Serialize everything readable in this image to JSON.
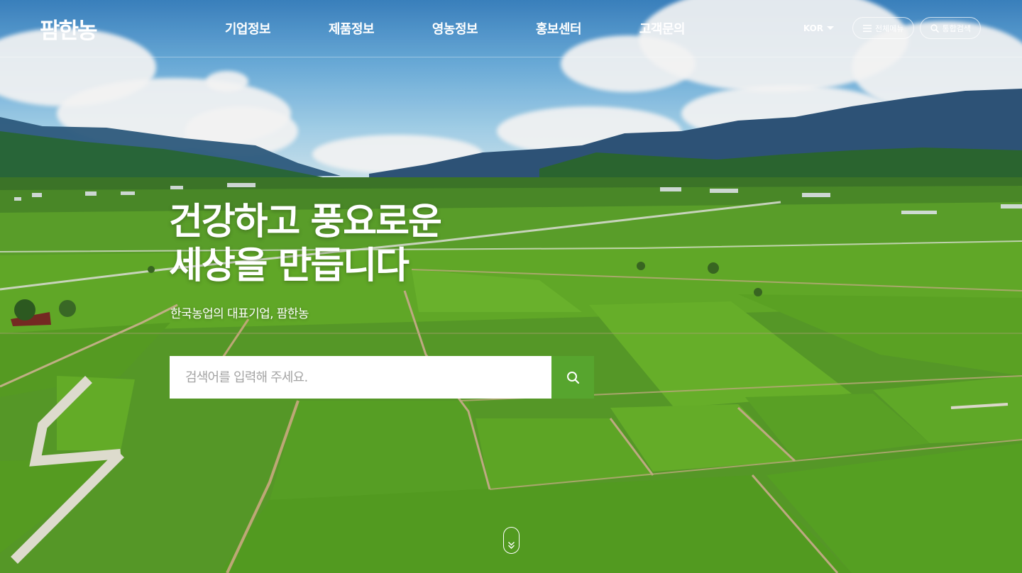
{
  "brand": {
    "logo_text": "팜한농"
  },
  "nav": {
    "items": [
      {
        "label": "기업정보"
      },
      {
        "label": "제품정보"
      },
      {
        "label": "영농정보"
      },
      {
        "label": "홍보센터"
      },
      {
        "label": "고객문의"
      }
    ]
  },
  "utility": {
    "language": "KOR",
    "all_menu_label": "전체메뉴",
    "search_label": "통합검색"
  },
  "hero": {
    "headline_line1": "건강하고 풍요로운",
    "headline_line2": "세상을 만듭니다",
    "subline": "한국농업의 대표기업, 팜한농"
  },
  "search": {
    "placeholder": "검색어를 입력해 주세요."
  },
  "colors": {
    "accent": "#57a52e",
    "text": "#ffffff"
  },
  "icons": {
    "menu": "hamburger-icon",
    "search": "search-icon",
    "language_dropdown": "caret-down-icon",
    "scroll": "double-chevron-down-icon"
  }
}
